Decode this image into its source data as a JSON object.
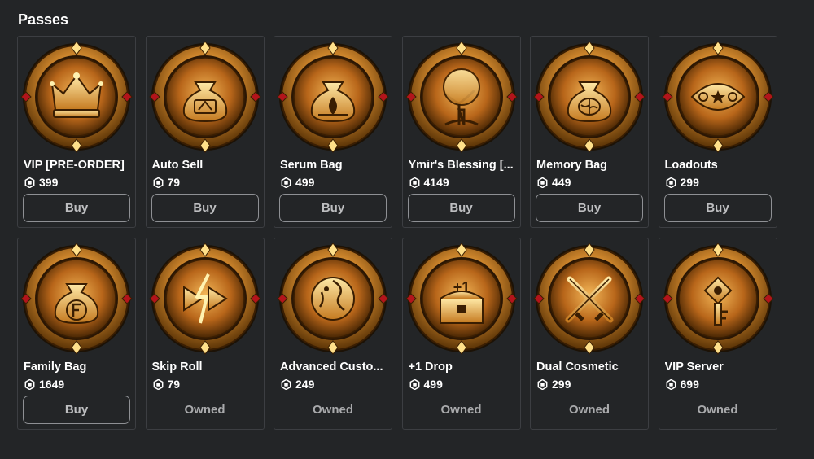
{
  "page": {
    "title": "Passes"
  },
  "colors": {
    "background": "#232527",
    "card_border": "#3c3e42",
    "gold_dark": "#5a3306",
    "gold_mid": "#c9822a",
    "gold_light": "#ffe08a",
    "diamond_red": "#b3141b"
  },
  "passes": [
    {
      "name": "VIP [PRE-ORDER]",
      "price": "399",
      "action": "Buy",
      "owned": false,
      "icon": "crown-icon"
    },
    {
      "name": "Auto Sell",
      "price": "79",
      "action": "Buy",
      "owned": false,
      "icon": "money-bag-icon"
    },
    {
      "name": "Serum Bag",
      "price": "499",
      "action": "Buy",
      "owned": false,
      "icon": "serum-bag-icon"
    },
    {
      "name": "Ymir's Blessing [...",
      "price": "4149",
      "action": "Buy",
      "owned": false,
      "icon": "tree-icon"
    },
    {
      "name": "Memory Bag",
      "price": "449",
      "action": "Buy",
      "owned": false,
      "icon": "brain-bag-icon"
    },
    {
      "name": "Loadouts",
      "price": "299",
      "action": "Buy",
      "owned": false,
      "icon": "loadouts-icon"
    },
    {
      "name": "Family Bag",
      "price": "1649",
      "action": "Buy",
      "owned": false,
      "icon": "family-bag-icon"
    },
    {
      "name": "Skip Roll",
      "price": "79",
      "action": "Owned",
      "owned": true,
      "icon": "skip-icon"
    },
    {
      "name": "Advanced Custo...",
      "price": "249",
      "action": "Owned",
      "owned": true,
      "icon": "customize-icon"
    },
    {
      "name": "+1 Drop",
      "price": "499",
      "action": "Owned",
      "owned": true,
      "icon": "chest-icon"
    },
    {
      "name": "Dual Cosmetic",
      "price": "299",
      "action": "Owned",
      "owned": true,
      "icon": "crossed-swords-icon"
    },
    {
      "name": "VIP Server",
      "price": "699",
      "action": "Owned",
      "owned": true,
      "icon": "key-icon"
    }
  ]
}
